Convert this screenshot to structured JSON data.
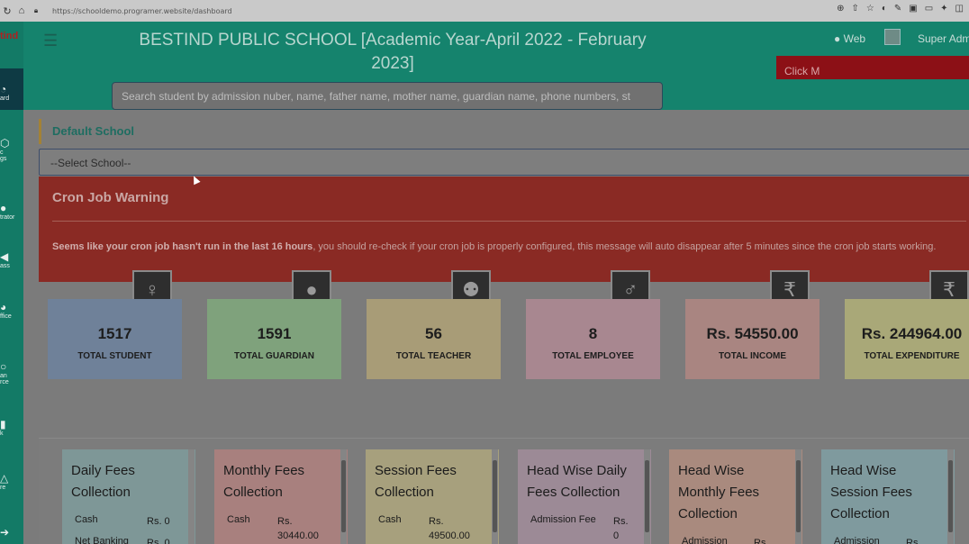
{
  "browser": {
    "url": "https://schooldemo.programer.website/dashboard"
  },
  "sidebar": {
    "logo": "tind",
    "items": [
      {
        "label": "ard",
        "icon": "dashboard-icon"
      },
      {
        "label": "c\ngs",
        "icon": "settings-icon"
      },
      {
        "label": "trator",
        "icon": "administrator-icon"
      },
      {
        "label": "ass",
        "icon": "class-icon"
      },
      {
        "label": "ffice",
        "icon": "office-icon"
      },
      {
        "label": "an\nrce",
        "icon": "human-resource-icon"
      },
      {
        "label": "k",
        "icon": "book-icon"
      },
      {
        "label": "re",
        "icon": "leave-icon"
      }
    ]
  },
  "header": {
    "title_line1": "BESTIND PUBLIC SCHOOL [Academic Year-April 2022 - February",
    "title_line2": "2023]",
    "search_placeholder": "Search student by admission nuber, name, father name, mother name, guardian name, phone numbers, st",
    "web_label": "Web",
    "user_name": "Super Adm",
    "banner_text": "Click M"
  },
  "main": {
    "default_school_label": "Default School",
    "select_school": "--Select School--",
    "cron": {
      "title": "Cron Job Warning",
      "message_bold": "Seems like your cron job hasn't run in the last 16 hours",
      "message_rest": ", you should re-check if your cron job is properly configured, this message will auto disappear after 5 minutes since the cron job starts working."
    },
    "stats": [
      {
        "value": "1517",
        "label": "TOTAL STUDENT",
        "icon": "child-icon",
        "color": "#6f8199"
      },
      {
        "value": "1591",
        "label": "TOTAL GUARDIAN",
        "icon": "user-icon",
        "color": "#7fa27c"
      },
      {
        "value": "56",
        "label": "TOTAL TEACHER",
        "icon": "users-icon",
        "color": "#a89c77"
      },
      {
        "value": "8",
        "label": "TOTAL EMPLOYEE",
        "icon": "person-icon",
        "color": "#a88790"
      },
      {
        "value": "Rs. 54550.00",
        "label": "TOTAL INCOME",
        "icon": "rupee-icon",
        "color": "#a98581"
      },
      {
        "value": "Rs. 244964.00",
        "label": "TOTAL EXPENDITURE",
        "icon": "rupee-icon",
        "color": "#a9a878"
      }
    ],
    "fee_cards": [
      {
        "title": "Daily Fees Collection",
        "color": "#7e9797",
        "rows": [
          {
            "k": "Cash",
            "v": "Rs. 0"
          },
          {
            "k": "Net Banking",
            "v": "Rs. 0"
          }
        ]
      },
      {
        "title": "Monthly Fees Collection",
        "color": "#a8807e",
        "rows": [
          {
            "k": "Cash",
            "v": "Rs. 30440.00"
          }
        ]
      },
      {
        "title": "Session Fees Collection",
        "color": "#a7a07d",
        "rows": [
          {
            "k": "Cash",
            "v": "Rs. 49500.00"
          }
        ]
      },
      {
        "title": "Head Wise Daily Fees Collection",
        "color": "#9c8a96",
        "rows": [
          {
            "k": "Admission Fee",
            "v": "Rs. 0"
          }
        ]
      },
      {
        "title": "Head Wise Monthly Fees Collection",
        "color": "#a98a7e",
        "rows": [
          {
            "k": "Admission",
            "v": "Rs"
          }
        ]
      },
      {
        "title": "Head Wise Session Fees Collection",
        "color": "#7f9a9e",
        "rows": [
          {
            "k": "Admission",
            "v": "Rs"
          }
        ]
      }
    ]
  }
}
